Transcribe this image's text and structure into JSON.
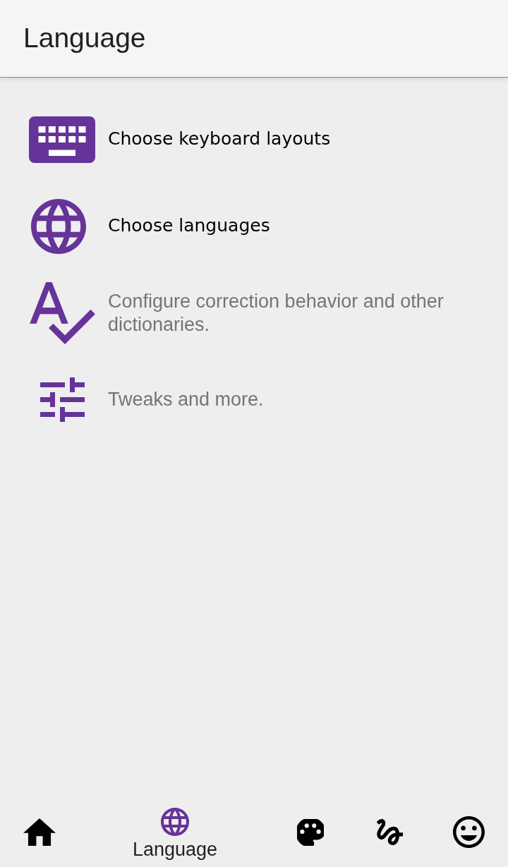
{
  "app_bar": {
    "title": "Language"
  },
  "items": [
    {
      "kind": "keyboard",
      "title": "Choose keyboard layouts"
    },
    {
      "kind": "language",
      "title": "Choose languages"
    },
    {
      "kind": "spellcheck",
      "summary": "Configure correction behavior and other dictionaries."
    },
    {
      "kind": "tune",
      "summary": "Tweaks and more."
    }
  ],
  "bottom_nav": [
    {
      "kind": "home",
      "selected": false
    },
    {
      "kind": "language",
      "selected": true,
      "label": "Language"
    },
    {
      "kind": "palette",
      "selected": false
    },
    {
      "kind": "gesture",
      "selected": false
    },
    {
      "kind": "emoji",
      "selected": false
    }
  ]
}
